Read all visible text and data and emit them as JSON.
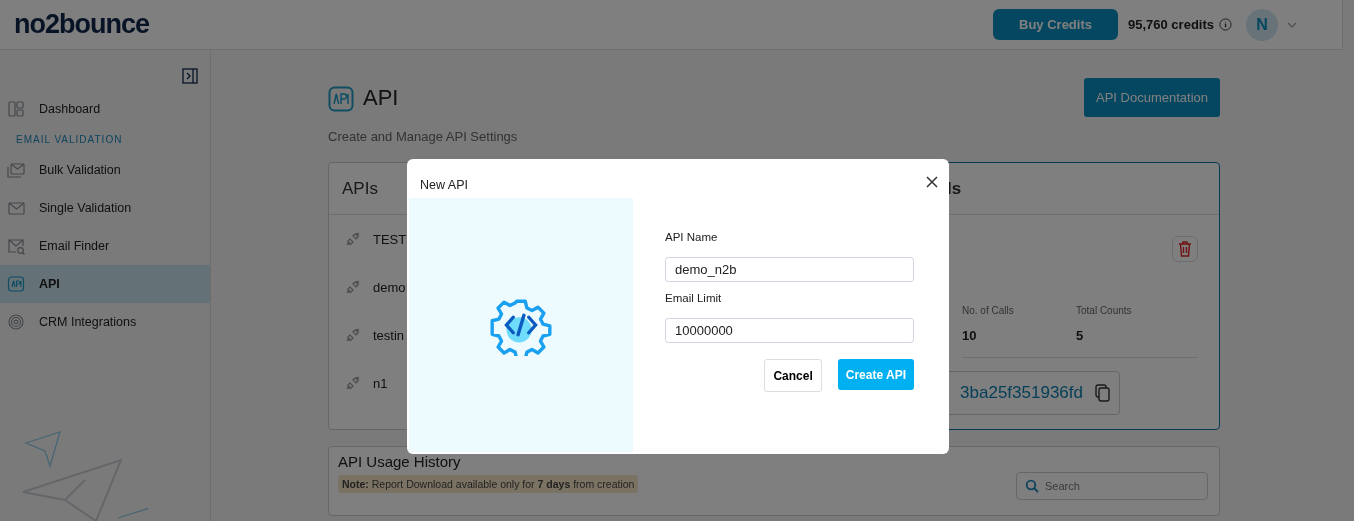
{
  "header": {
    "logo": "no2bounce",
    "buy_button": "Buy Credits",
    "credits": "95,760 credits",
    "avatar": "N"
  },
  "sidebar": {
    "items": [
      {
        "label": "Dashboard",
        "selected": false
      }
    ],
    "section": {
      "title": "EMAIL VALIDATION",
      "items": [
        {
          "label": "Bulk Validation",
          "selected": false
        },
        {
          "label": "Single Validation",
          "selected": false
        },
        {
          "label": "Email Finder",
          "selected": false
        },
        {
          "label": "API",
          "selected": true
        },
        {
          "label": "CRM Integrations",
          "selected": false
        }
      ]
    }
  },
  "page": {
    "title": "API",
    "subtitle": "Create and Manage API Settings",
    "doc_button": "API Documentation"
  },
  "apis_card": {
    "title": "APIs",
    "items": [
      "TEST",
      "demo",
      "testin",
      "n1"
    ]
  },
  "details_card": {
    "title": "ls",
    "stats": [
      {
        "label": "No. of Calls",
        "value": "10"
      },
      {
        "label": "Total Counts",
        "value": "5"
      }
    ],
    "key": "3ba25f351936fd"
  },
  "usage_card": {
    "title": "API Usage History",
    "search": {
      "placeholder": "Search"
    },
    "note": "**Note:** Report Download available only for **7 days** from creation"
  },
  "modal": {
    "title": "New API",
    "fields": [
      {
        "label": "API Name",
        "value": "demo_n2b"
      },
      {
        "label": "Email Limit",
        "value": "10000000"
      }
    ],
    "cancel": "Cancel",
    "submit": "Create API"
  }
}
